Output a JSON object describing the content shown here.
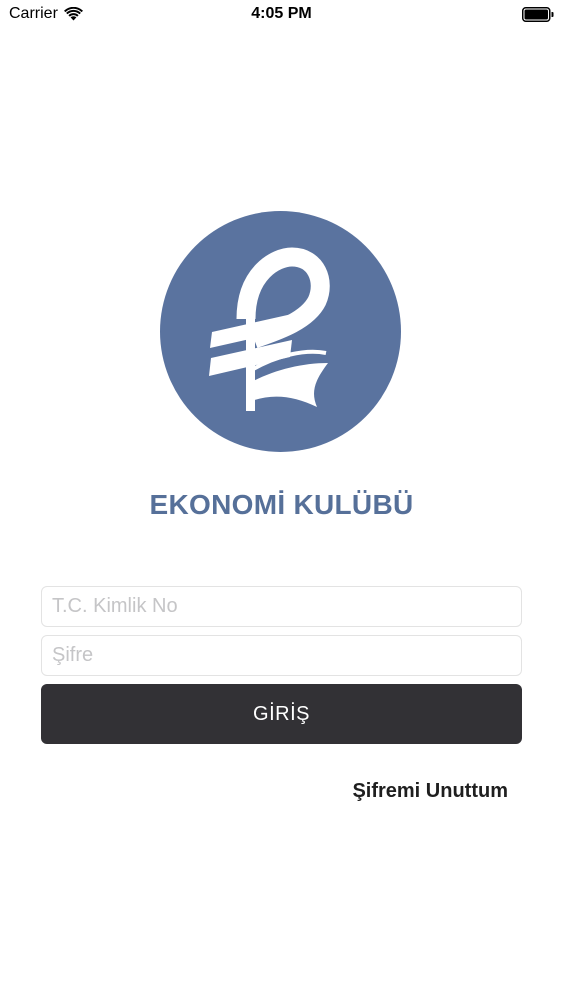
{
  "status_bar": {
    "carrier": "Carrier",
    "time": "4:05 PM",
    "icons": [
      "wifi-icon",
      "battery-icon"
    ]
  },
  "logo": {
    "icon": "euro-logo-icon",
    "circle_color": "#5a739f"
  },
  "app": {
    "title": "EKONOMİ KULÜBÜ",
    "title_color": "#567099"
  },
  "login_form": {
    "tc_placeholder": "T.C. Kimlik No",
    "tc_value": "",
    "password_placeholder": "Şifre",
    "password_value": "",
    "submit_label": "GİRİŞ",
    "button_color": "#323135",
    "forgot_label": "Şifremi Unuttum"
  }
}
